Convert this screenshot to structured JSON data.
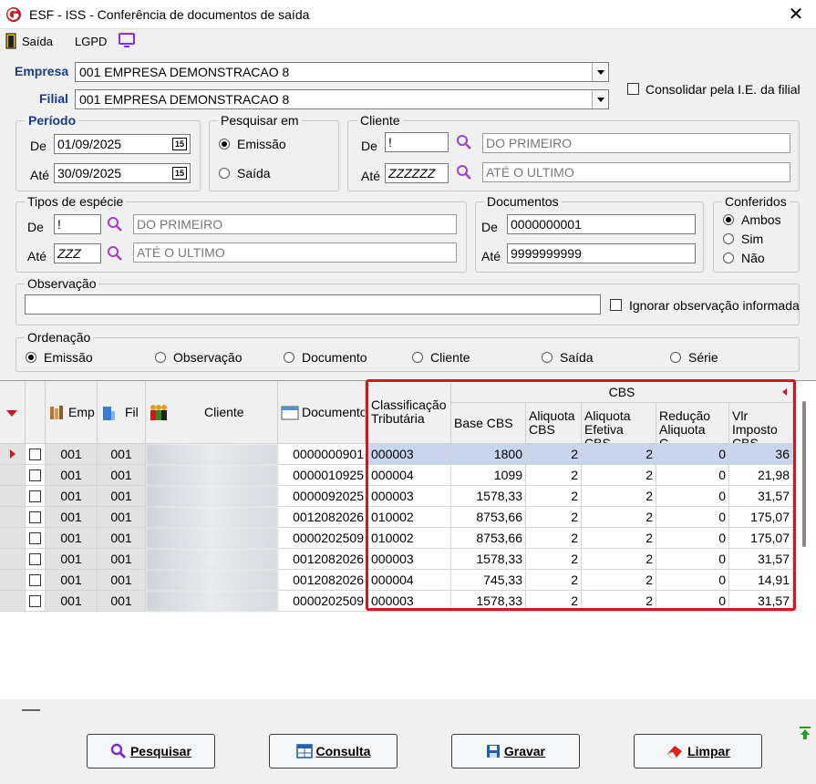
{
  "window": {
    "title": "ESF - ISS - Conferência de documentos de saída",
    "close": "✕"
  },
  "toolbar": {
    "saida": "Saída",
    "lgpd": "LGPD"
  },
  "empresa": {
    "label": "Empresa",
    "value": "001 EMPRESA DEMONSTRACAO 8"
  },
  "filial": {
    "label": "Filial",
    "value": "001 EMPRESA DEMONSTRACAO 8"
  },
  "consolidar": {
    "label": "Consolidar pela I.E. da filial"
  },
  "periodo": {
    "legend": "Período",
    "de_label": "De",
    "de": "01/09/2025",
    "ate_label": "Até",
    "ate": "30/09/2025",
    "cal": "15"
  },
  "pesquisar_em": {
    "legend": "Pesquisar em",
    "emissao": "Emissão",
    "saida": "Saída"
  },
  "cliente": {
    "legend": "Cliente",
    "de_label": "De",
    "de": "!",
    "de_desc": "DO PRIMEIRO",
    "ate_label": "Até",
    "ate": "ZZZZZZ",
    "ate_desc": "ATÉ O ULTIMO"
  },
  "tipos": {
    "legend": "Tipos de espécie",
    "de_label": "De",
    "de": "!",
    "de_desc": "DO PRIMEIRO",
    "ate_label": "Até",
    "ate": "ZZZ",
    "ate_desc": "ATÉ O ULTIMO"
  },
  "documentos": {
    "legend": "Documentos",
    "de_label": "De",
    "de": "0000000001",
    "ate_label": "Até",
    "ate": "9999999999"
  },
  "conferidos": {
    "legend": "Conferidos",
    "ambos": "Ambos",
    "sim": "Sim",
    "nao": "Não"
  },
  "observacao": {
    "legend": "Observação",
    "value": "",
    "ignorar": "Ignorar observação informada"
  },
  "ordenacao": {
    "legend": "Ordenação",
    "options": [
      "Emissão",
      "Observação",
      "Documento",
      "Cliente",
      "Saída",
      "Série"
    ]
  },
  "grid": {
    "headers": {
      "emp": "Emp",
      "fil": "Fil",
      "cliente": "Cliente",
      "documento": "Documento",
      "class_trib": "Classificação Tributária",
      "cbs_group": "CBS",
      "base_cbs": "Base CBS",
      "aliquota_cbs": "Aliquota CBS",
      "aliquota_efetiva": "Aliquota Efetiva CBS",
      "reducao": "Redução Aliquota C...",
      "vlr_imposto": "Vlr Imposto CBS"
    },
    "rows": [
      {
        "emp": "001",
        "fil": "001",
        "documento": "0000000901",
        "class_trib": "000003",
        "base": "1800",
        "aliq": "2",
        "aliq_ef": "2",
        "red": "0",
        "vlr": "36"
      },
      {
        "emp": "001",
        "fil": "001",
        "documento": "0000010925",
        "class_trib": "000004",
        "base": "1099",
        "aliq": "2",
        "aliq_ef": "2",
        "red": "0",
        "vlr": "21,98"
      },
      {
        "emp": "001",
        "fil": "001",
        "documento": "0000092025",
        "class_trib": "000003",
        "base": "1578,33",
        "aliq": "2",
        "aliq_ef": "2",
        "red": "0",
        "vlr": "31,57"
      },
      {
        "emp": "001",
        "fil": "001",
        "documento": "0012082026",
        "class_trib": "010002",
        "base": "8753,66",
        "aliq": "2",
        "aliq_ef": "2",
        "red": "0",
        "vlr": "175,07"
      },
      {
        "emp": "001",
        "fil": "001",
        "documento": "0000202509",
        "class_trib": "010002",
        "base": "8753,66",
        "aliq": "2",
        "aliq_ef": "2",
        "red": "0",
        "vlr": "175,07"
      },
      {
        "emp": "001",
        "fil": "001",
        "documento": "0012082026",
        "class_trib": "000003",
        "base": "1578,33",
        "aliq": "2",
        "aliq_ef": "2",
        "red": "0",
        "vlr": "31,57"
      },
      {
        "emp": "001",
        "fil": "001",
        "documento": "0012082026",
        "class_trib": "000004",
        "base": "745,33",
        "aliq": "2",
        "aliq_ef": "2",
        "red": "0",
        "vlr": "14,91"
      },
      {
        "emp": "001",
        "fil": "001",
        "documento": "0000202509",
        "class_trib": "000003",
        "base": "1578,33",
        "aliq": "2",
        "aliq_ef": "2",
        "red": "0",
        "vlr": "31,57"
      }
    ]
  },
  "buttons": {
    "pesquisar": "Pesquisar",
    "consulta": "Consulta",
    "gravar": "Gravar",
    "limpar": "Limpar"
  },
  "colors": {
    "accent_blue": "#1a3a8a",
    "highlight_red": "#d4141e",
    "selection": "#c7d6ee"
  }
}
